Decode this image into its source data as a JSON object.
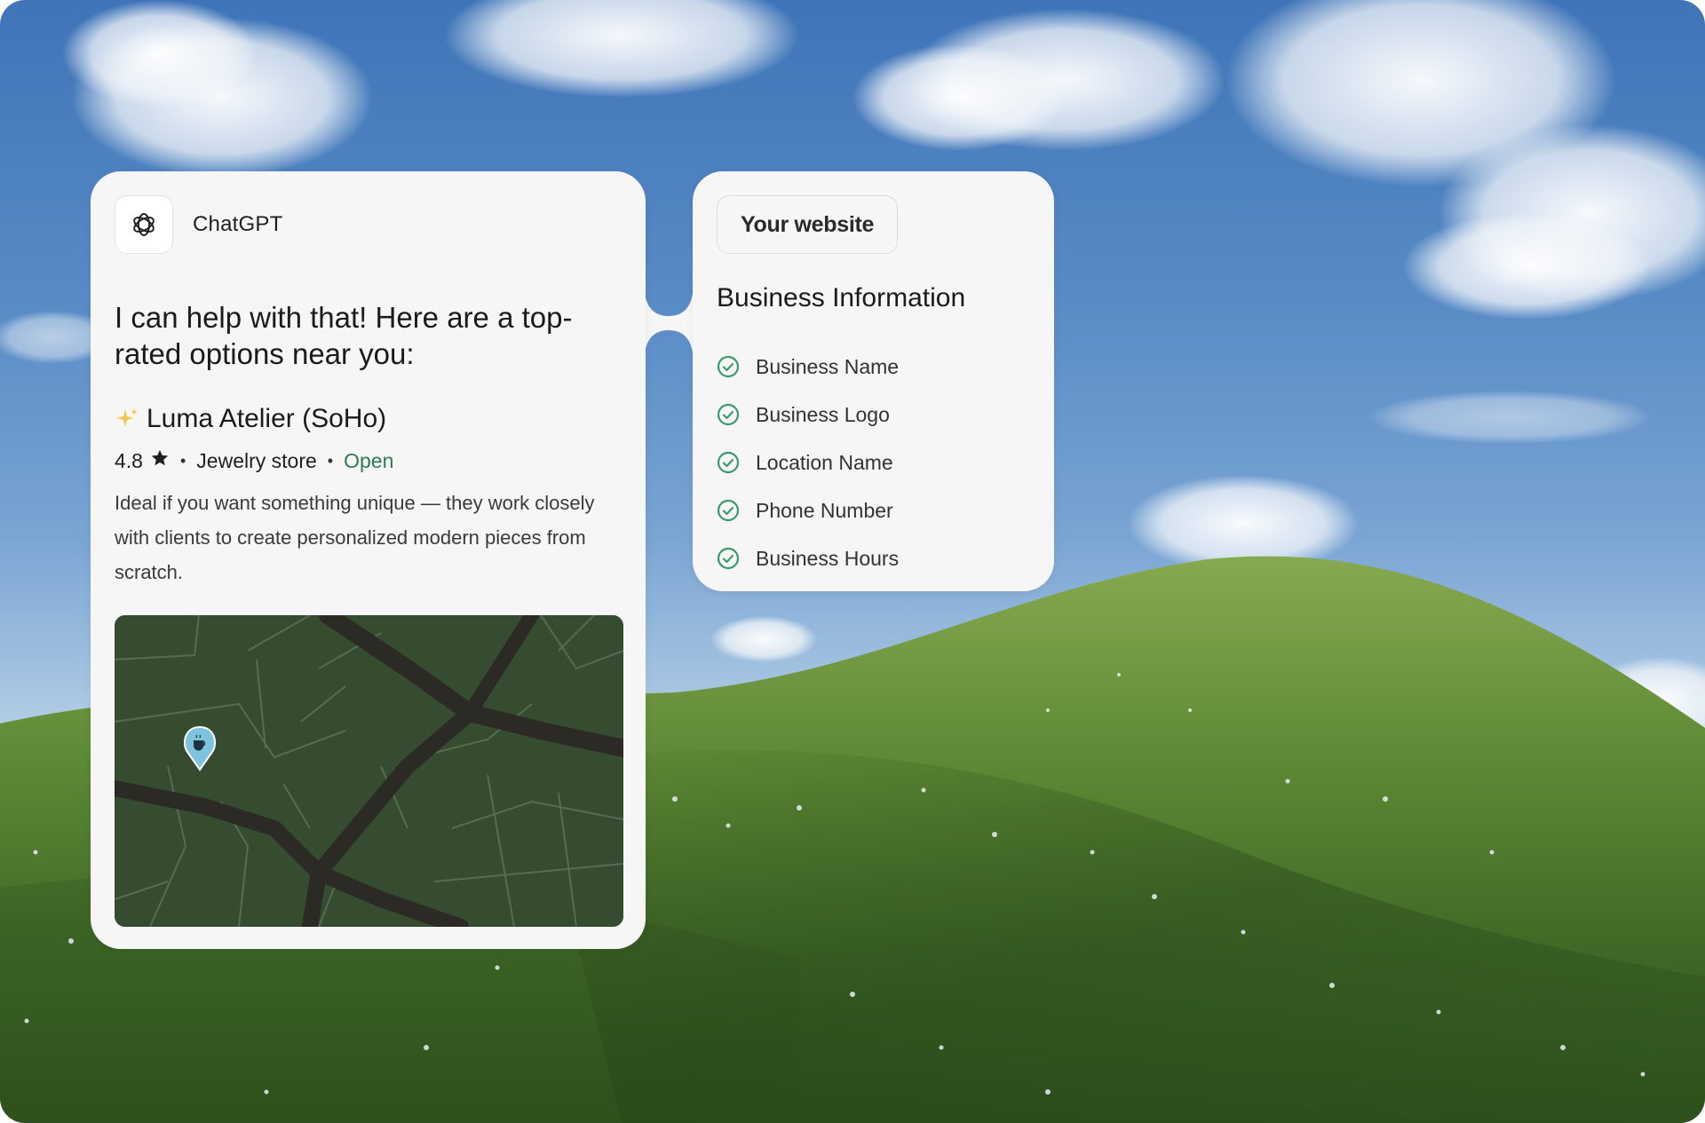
{
  "assistant": {
    "app_name": "ChatGPT",
    "logo_icon": "openai-logo-icon",
    "message": "I can help with that! Here are a top-rated options near you:",
    "result": {
      "icon": "sparkles-icon",
      "name": "Luma Atelier (SoHo)",
      "rating": "4.8",
      "rating_icon": "star-icon",
      "category": "Jewelry store",
      "status": "Open",
      "description": "Ideal if you want something unique — they work closely with clients to create personalized modern pieces from scratch.",
      "map_pin_icon": "coffee-map-pin-icon"
    }
  },
  "website": {
    "label": "Your website",
    "section_title": "Business Information",
    "items": [
      {
        "label": "Business Name",
        "icon": "check-circle-icon"
      },
      {
        "label": "Business Logo",
        "icon": "check-circle-icon"
      },
      {
        "label": "Location Name",
        "icon": "check-circle-icon"
      },
      {
        "label": "Phone Number",
        "icon": "check-circle-icon"
      },
      {
        "label": "Business Hours",
        "icon": "check-circle-icon"
      }
    ]
  },
  "colors": {
    "card_bg": "#f6f6f7",
    "check_green": "#3a9a6e",
    "open_green": "#2f7a52",
    "map_bg": "#354c30",
    "map_pin": "#7fc4df"
  }
}
